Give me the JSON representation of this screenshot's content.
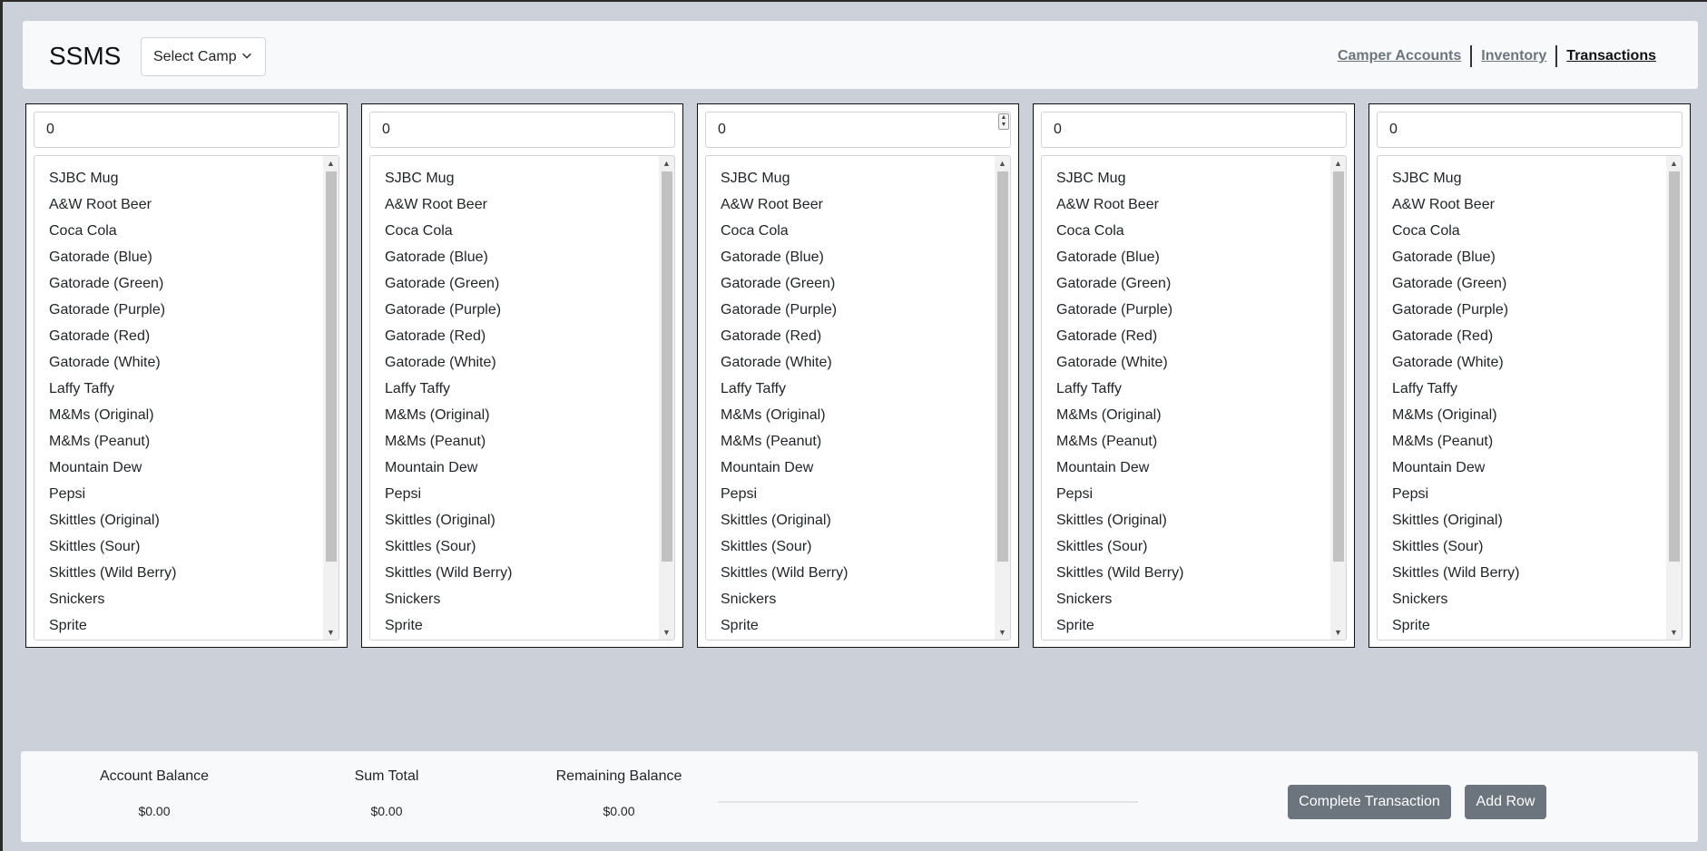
{
  "header": {
    "brand": "SSMS",
    "camp_select": "Select Camp",
    "nav": [
      "Camper Accounts",
      "Inventory",
      "Transactions"
    ],
    "active_nav": "Transactions"
  },
  "columns": [
    {
      "quantity": "0"
    },
    {
      "quantity": "0"
    },
    {
      "quantity": "0"
    },
    {
      "quantity": "0"
    },
    {
      "quantity": "0"
    }
  ],
  "items": [
    "SJBC Mug",
    "A&W Root Beer",
    "Coca Cola",
    "Gatorade (Blue)",
    "Gatorade (Green)",
    "Gatorade (Purple)",
    "Gatorade (Red)",
    "Gatorade (White)",
    "Laffy Taffy",
    "M&Ms (Original)",
    "M&Ms (Peanut)",
    "Mountain Dew",
    "Pepsi",
    "Skittles (Original)",
    "Skittles (Sour)",
    "Skittles (Wild Berry)",
    "Snickers",
    "Sprite"
  ],
  "footer": {
    "account_balance_label": "Account Balance",
    "account_balance_value": "$0.00",
    "sum_total_label": "Sum Total",
    "sum_total_value": "$0.00",
    "remaining_balance_label": "Remaining Balance",
    "remaining_balance_value": "$0.00",
    "complete_button": "Complete Transaction",
    "add_row_button": "Add Row"
  },
  "colors": {
    "page_bg": "#ccd0d8",
    "panel_bg": "#f8f9fa",
    "button_bg": "#6c757d"
  }
}
